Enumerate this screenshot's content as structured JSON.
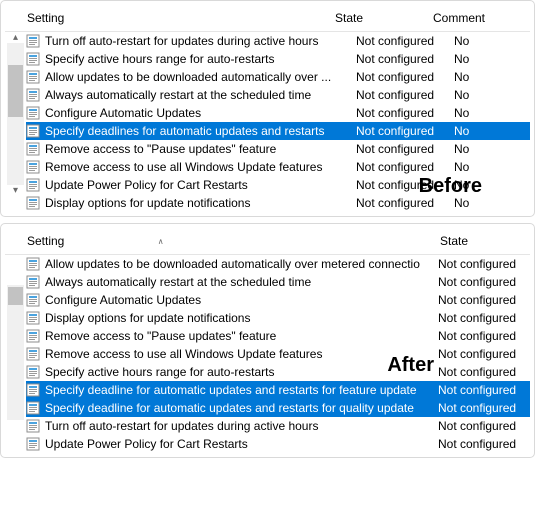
{
  "headers": {
    "setting": "Setting",
    "state": "State",
    "comment": "Comment"
  },
  "annotations": {
    "before": "Before",
    "after": "After"
  },
  "before": {
    "rows": [
      {
        "setting": "Turn off auto-restart for updates during active hours",
        "state": "Not configured",
        "comment": "No",
        "selected": false
      },
      {
        "setting": "Specify active hours range for auto-restarts",
        "state": "Not configured",
        "comment": "No",
        "selected": false
      },
      {
        "setting": "Allow updates to be downloaded automatically over ...",
        "state": "Not configured",
        "comment": "No",
        "selected": false
      },
      {
        "setting": "Always automatically restart at the scheduled time",
        "state": "Not configured",
        "comment": "No",
        "selected": false
      },
      {
        "setting": "Configure Automatic Updates",
        "state": "Not configured",
        "comment": "No",
        "selected": false
      },
      {
        "setting": "Specify deadlines for automatic updates and restarts",
        "state": "Not configured",
        "comment": "No",
        "selected": true
      },
      {
        "setting": "Remove access to \"Pause updates\" feature",
        "state": "Not configured",
        "comment": "No",
        "selected": false
      },
      {
        "setting": "Remove access to use all Windows Update features",
        "state": "Not configured",
        "comment": "No",
        "selected": false
      },
      {
        "setting": "Update Power Policy for Cart Restarts",
        "state": "Not configured",
        "comment": "No",
        "selected": false
      },
      {
        "setting": "Display options for update notifications",
        "state": "Not configured",
        "comment": "No",
        "selected": false
      }
    ]
  },
  "after": {
    "rows": [
      {
        "setting": "Allow updates to be downloaded automatically over metered connectio",
        "state": "Not configured",
        "selected": false
      },
      {
        "setting": "Always automatically restart at the scheduled time",
        "state": "Not configured",
        "selected": false
      },
      {
        "setting": "Configure Automatic Updates",
        "state": "Not configured",
        "selected": false
      },
      {
        "setting": "Display options for update notifications",
        "state": "Not configured",
        "selected": false
      },
      {
        "setting": "Remove access to \"Pause updates\" feature",
        "state": "Not configured",
        "selected": false
      },
      {
        "setting": "Remove access to use all Windows Update features",
        "state": "Not configured",
        "selected": false
      },
      {
        "setting": "Specify active hours range for auto-restarts",
        "state": "Not configured",
        "selected": false
      },
      {
        "setting": "Specify deadline for automatic updates and restarts for feature update",
        "state": "Not configured",
        "selected": true
      },
      {
        "setting": "Specify deadline for automatic updates and restarts for quality update",
        "state": "Not configured",
        "selected": true
      },
      {
        "setting": "Turn off auto-restart for updates during active hours",
        "state": "Not configured",
        "selected": false
      },
      {
        "setting": "Update Power Policy for Cart Restarts",
        "state": "Not configured",
        "selected": false
      }
    ]
  }
}
